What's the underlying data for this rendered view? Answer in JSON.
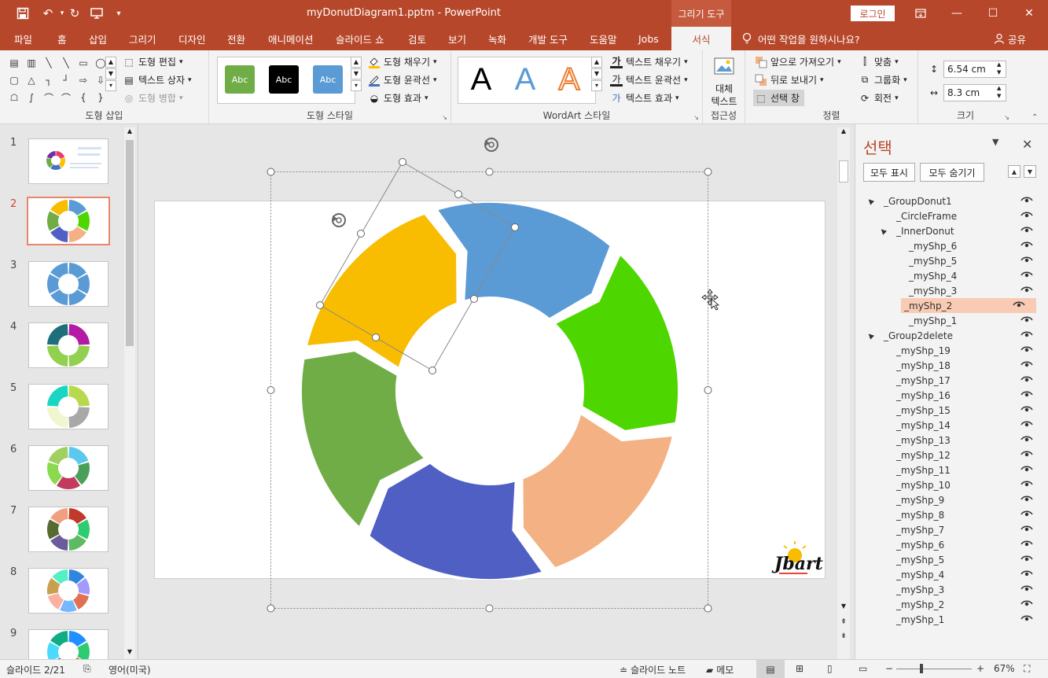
{
  "titlebar": {
    "doc_title": "myDonutDiagram1.pptm  -  PowerPoint",
    "context_tab_title": "그리기 도구",
    "login": "로그인",
    "quick_access": [
      "save-icon",
      "undo-icon",
      "redo-icon",
      "present-icon",
      "customize-icon"
    ]
  },
  "tabs": [
    {
      "label": "파일"
    },
    {
      "label": "홈"
    },
    {
      "label": "삽입"
    },
    {
      "label": "그리기"
    },
    {
      "label": "디자인"
    },
    {
      "label": "전환"
    },
    {
      "label": "애니메이션"
    },
    {
      "label": "슬라이드 쇼"
    },
    {
      "label": "검토"
    },
    {
      "label": "보기"
    },
    {
      "label": "녹화"
    },
    {
      "label": "개발 도구"
    },
    {
      "label": "도움말"
    },
    {
      "label": "Jobs"
    },
    {
      "label": "서식"
    }
  ],
  "tell_me": "어떤 작업을 원하시나요?",
  "share": "공유",
  "ribbon": {
    "insert_shapes": {
      "label": "도형 삽입",
      "edit_shape": "도형 편집",
      "text_box": "텍스트 상자",
      "merge_shapes": "도형 병합"
    },
    "shape_styles": {
      "label": "도형 스타일",
      "presets": [
        {
          "text": "Abc",
          "color": "#70ad47"
        },
        {
          "text": "Abc",
          "color": "#000000"
        },
        {
          "text": "Abc",
          "color": "#5b9bd5"
        }
      ],
      "fill": "도형 채우기",
      "outline": "도형 윤곽선",
      "effects": "도형 효과"
    },
    "wordart": {
      "label": "WordArt 스타일",
      "letter": "A",
      "text_fill": "텍스트 채우기",
      "text_outline": "텍스트 윤곽선",
      "text_effects": "텍스트 효과"
    },
    "accessibility": {
      "label": "접근성",
      "alt_text_line1": "대체",
      "alt_text_line2": "텍스트"
    },
    "arrange": {
      "label": "정렬",
      "bring_forward": "앞으로 가져오기",
      "send_backward": "뒤로 보내기",
      "selection_pane": "선택 창",
      "align": "맞춤",
      "group": "그룹화",
      "rotate": "회전"
    },
    "size": {
      "label": "크기",
      "height": "6.54 cm",
      "width": "8.3 cm"
    }
  },
  "slides": {
    "active_index": 2,
    "items": [
      {
        "num": "1",
        "colors": [
          "#e73c6e",
          "#ffc000",
          "#4472c4",
          "#70ad47",
          "#7030a0"
        ]
      },
      {
        "num": "2",
        "colors": [
          "#5b9bd5",
          "#4ed600",
          "#f4b183",
          "#4f5fc4",
          "#70ad47",
          "#f8bc00"
        ]
      },
      {
        "num": "3",
        "colors": [
          "#5b9bd5",
          "#5b9bd5",
          "#5b9bd5",
          "#5b9bd5",
          "#5b9bd5",
          "#5b9bd5"
        ]
      },
      {
        "num": "4",
        "colors": [
          "#b41aa5",
          "#92d050",
          "#92d050",
          "#1f6f7a"
        ]
      },
      {
        "num": "5",
        "colors": [
          "#b8d94e",
          "#a8a8a8",
          "#eef7cf",
          "#19d6c2"
        ]
      },
      {
        "num": "6",
        "colors": [
          "#5bc8ee",
          "#4aa05a",
          "#c23b5e",
          "#8ad94e",
          "#a0d060"
        ]
      },
      {
        "num": "7",
        "colors": [
          "#c0392b",
          "#2ecc71",
          "#5dbb63",
          "#6c5b9a",
          "#556b2f",
          "#f0a080"
        ]
      },
      {
        "num": "8",
        "colors": [
          "#2e86de",
          "#a29bfe",
          "#e17055",
          "#74b9ff",
          "#fab1a0",
          "#c8a050",
          "#55efc4"
        ]
      },
      {
        "num": "9",
        "colors": [
          "#1e90ff",
          "#2ecc71",
          "#e74c3c",
          "#9b59b6",
          "#48dbfb",
          "#10ac84"
        ]
      }
    ]
  },
  "diagram": {
    "segments": [
      {
        "name": "blue",
        "color": "#5b9bd5"
      },
      {
        "name": "green",
        "color": "#4ed600"
      },
      {
        "name": "salmon",
        "color": "#f4b183"
      },
      {
        "name": "indigo",
        "color": "#4f5fc4"
      },
      {
        "name": "olive",
        "color": "#70ad47"
      },
      {
        "name": "yellow",
        "color": "#f8bc00"
      }
    ],
    "logo_text": "Jbart"
  },
  "selection_pane": {
    "title": "선택",
    "show_all": "모두 표시",
    "hide_all": "모두 숨기기",
    "items": [
      {
        "label": "_GroupDonut1",
        "level": 0,
        "expander": "▲",
        "selected": false
      },
      {
        "label": "_CircleFrame",
        "level": 1,
        "expander": "",
        "selected": false
      },
      {
        "label": "_InnerDonut",
        "level": 1,
        "expander": "▲",
        "selected": false
      },
      {
        "label": "_myShp_6",
        "level": 2,
        "expander": "",
        "selected": false
      },
      {
        "label": "_myShp_5",
        "level": 2,
        "expander": "",
        "selected": false
      },
      {
        "label": "_myShp_4",
        "level": 2,
        "expander": "",
        "selected": false
      },
      {
        "label": "_myShp_3",
        "level": 2,
        "expander": "",
        "selected": false
      },
      {
        "label": "_myShp_2",
        "level": 2,
        "expander": "",
        "selected": true
      },
      {
        "label": "_myShp_1",
        "level": 2,
        "expander": "",
        "selected": false
      },
      {
        "label": "_Group2delete",
        "level": 0,
        "expander": "▲",
        "selected": false
      },
      {
        "label": "_myShp_19",
        "level": 1,
        "expander": "",
        "selected": false
      },
      {
        "label": "_myShp_18",
        "level": 1,
        "expander": "",
        "selected": false
      },
      {
        "label": "_myShp_17",
        "level": 1,
        "expander": "",
        "selected": false
      },
      {
        "label": "_myShp_16",
        "level": 1,
        "expander": "",
        "selected": false
      },
      {
        "label": "_myShp_15",
        "level": 1,
        "expander": "",
        "selected": false
      },
      {
        "label": "_myShp_14",
        "level": 1,
        "expander": "",
        "selected": false
      },
      {
        "label": "_myShp_13",
        "level": 1,
        "expander": "",
        "selected": false
      },
      {
        "label": "_myShp_12",
        "level": 1,
        "expander": "",
        "selected": false
      },
      {
        "label": "_myShp_11",
        "level": 1,
        "expander": "",
        "selected": false
      },
      {
        "label": "_myShp_10",
        "level": 1,
        "expander": "",
        "selected": false
      },
      {
        "label": "_myShp_9",
        "level": 1,
        "expander": "",
        "selected": false
      },
      {
        "label": "_myShp_8",
        "level": 1,
        "expander": "",
        "selected": false
      },
      {
        "label": "_myShp_7",
        "level": 1,
        "expander": "",
        "selected": false
      },
      {
        "label": "_myShp_6",
        "level": 1,
        "expander": "",
        "selected": false
      },
      {
        "label": "_myShp_5",
        "level": 1,
        "expander": "",
        "selected": false
      },
      {
        "label": "_myShp_4",
        "level": 1,
        "expander": "",
        "selected": false
      },
      {
        "label": "_myShp_3",
        "level": 1,
        "expander": "",
        "selected": false
      },
      {
        "label": "_myShp_2",
        "level": 1,
        "expander": "",
        "selected": false
      },
      {
        "label": "_myShp_1",
        "level": 1,
        "expander": "",
        "selected": false
      }
    ]
  },
  "status": {
    "slide_info": "슬라이드 2/21",
    "language": "영어(미국)",
    "notes": "슬라이드 노트",
    "comments": "메모",
    "zoom": "67%"
  }
}
